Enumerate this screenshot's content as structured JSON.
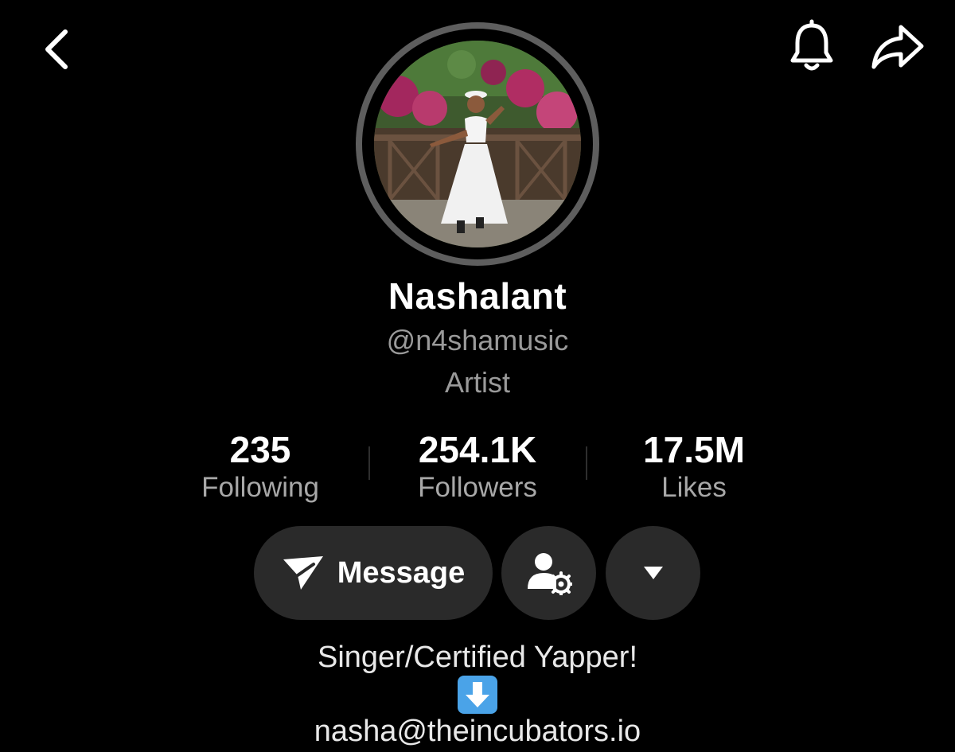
{
  "header": {
    "back_icon": "chevron-left-icon",
    "bell_icon": "bell-icon",
    "share_icon": "share-arrow-icon"
  },
  "profile": {
    "avatar": "profile-photo-woman-white-outfit",
    "display_name": "Nashalant",
    "handle": "@n4shamusic",
    "category": "Artist"
  },
  "stats": [
    {
      "value": "235",
      "label": "Following"
    },
    {
      "value": "254.1K",
      "label": "Followers"
    },
    {
      "value": "17.5M",
      "label": "Likes"
    }
  ],
  "actions": {
    "message_label": "Message",
    "message_icon": "paper-plane-icon",
    "friend_settings_icon": "user-settings-icon",
    "more_icon": "caret-down-icon"
  },
  "bio": {
    "line1": "Singer/Certified Yapper!",
    "emoji": "down-arrow-emoji",
    "line2": "nasha@theincubators.io"
  },
  "colors": {
    "background": "#000000",
    "button_bg": "#2a2a2a",
    "secondary_text": "#9a9a9a",
    "avatar_ring": "#5e5e5e",
    "emoji_blue": "#4aa3e8"
  }
}
